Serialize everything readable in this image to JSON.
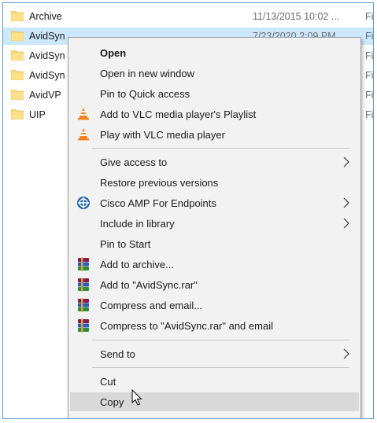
{
  "files": [
    {
      "name": "Archive",
      "date": "11/13/2015 10:02 ...",
      "type": "Fi",
      "selected": false
    },
    {
      "name": "AvidSyn",
      "date": "7/23/2020 2:09 PM",
      "type": "Fi",
      "selected": true
    },
    {
      "name": "AvidSyn",
      "date": "",
      "type": "Fi",
      "selected": false
    },
    {
      "name": "AvidSyn",
      "date": "",
      "type": "Fi",
      "selected": false
    },
    {
      "name": "AvidVP",
      "date": "",
      "type": "Fi",
      "selected": false
    },
    {
      "name": "UIP",
      "date": "",
      "type": "Fi",
      "selected": false
    }
  ],
  "context_menu": {
    "open": "Open",
    "open_new_window": "Open in new window",
    "pin_quick_access": "Pin to Quick access",
    "vlc_add_playlist": "Add to VLC media player's Playlist",
    "vlc_play": "Play with VLC media player",
    "give_access": "Give access to",
    "restore_versions": "Restore previous versions",
    "cisco_amp": "Cisco AMP For Endpoints",
    "include_library": "Include in library",
    "pin_start": "Pin to Start",
    "add_archive": "Add to archive...",
    "add_rar": "Add to \"AvidSync.rar\"",
    "compress_email": "Compress and email...",
    "compress_rar_email": "Compress to \"AvidSync.rar\" and email",
    "send_to": "Send to",
    "cut": "Cut",
    "copy": "Copy"
  },
  "colors": {
    "selection": "#cce8ff",
    "menu_background": "#f2f2f2",
    "menu_hover": "#d9d9d9",
    "folder_yellow": "#f8d775"
  },
  "icons": {
    "folder": "folder-icon",
    "vlc": "vlc-cone-icon",
    "cisco": "cisco-amp-icon",
    "winrar": "winrar-books-icon",
    "submenu": "chevron-right-icon",
    "cursor": "mouse-pointer-icon"
  }
}
